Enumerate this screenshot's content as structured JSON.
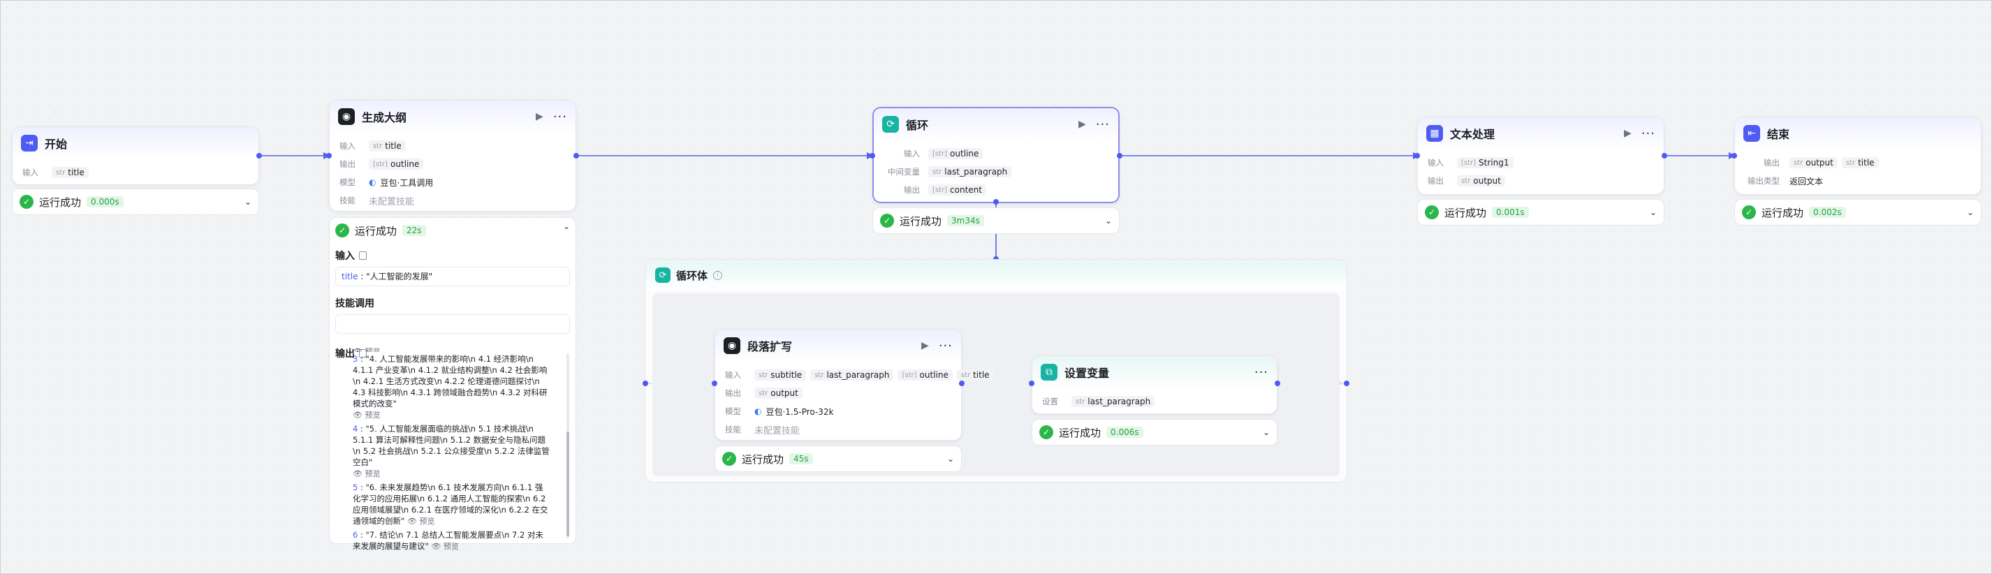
{
  "nodes": {
    "start": {
      "title": "开始",
      "input_label": "输入",
      "input_type": "str",
      "input_value": "title"
    },
    "outline": {
      "title": "生成大纲",
      "input_label": "输入",
      "input_type": "str",
      "input_value": "title",
      "output_label": "输出",
      "output_type": "[str]",
      "output_value": "outline",
      "model_label": "模型",
      "model_value": "豆包·工具调用",
      "skill_label": "技能",
      "skill_value": "未配置技能"
    },
    "loop": {
      "title": "循环",
      "input_label": "输入",
      "input_type": "[str]",
      "input_value": "outline",
      "mid_label": "中间变量",
      "mid_type": "str",
      "mid_value": "last_paragraph",
      "output_label": "输出",
      "output_type": "[str]",
      "output_value": "content"
    },
    "text": {
      "title": "文本处理",
      "input_label": "输入",
      "input_type": "[str]",
      "input_value": "String1",
      "output_label": "输出",
      "output_type": "str",
      "output_value": "output"
    },
    "end": {
      "title": "结束",
      "output_label": "输出",
      "output_type1": "str",
      "output_value1": "output",
      "output_type2": "str",
      "output_value2": "title",
      "otype_label": "输出类型",
      "otype_value": "返回文本"
    },
    "loopbody": {
      "title": "循环体"
    },
    "paragraph": {
      "title": "段落扩写",
      "input_label": "输入",
      "inputs": [
        {
          "type": "str",
          "value": "subtitle"
        },
        {
          "type": "str",
          "value": "last_paragraph"
        },
        {
          "type": "[str]",
          "value": "outline"
        },
        {
          "type": "str",
          "value": "title"
        }
      ],
      "output_label": "输出",
      "output_type": "str",
      "output_value": "output",
      "model_label": "模型",
      "model_value": "豆包·1.5-Pro-32k",
      "skill_label": "技能",
      "skill_value": "未配置技能"
    },
    "setvar": {
      "title": "设置变量",
      "set_label": "设置",
      "set_type": "str",
      "set_value": "last_paragraph"
    }
  },
  "status": {
    "text": "运行成功",
    "start_time": "0.000s",
    "outline_time": "22s",
    "loop_time": "3m34s",
    "text_time": "0.001s",
    "end_time": "0.002s",
    "paragraph_time": "45s",
    "setvar_time": "0.006s"
  },
  "panel": {
    "input_title": "输入",
    "input_key": "title",
    "input_value": "\"人工智能的发展\"",
    "skill_title": "技能调用",
    "output_title": "输出",
    "cut_preview": "预览",
    "preview_label": "预览",
    "items": [
      {
        "idx": "3",
        "text": "\"4. 人工智能发展带来的影响\\n 4.1 经济影响\\n 4.1.1 产业变革\\n 4.1.2 就业结构调整\\n 4.2 社会影响\\n 4.2.1 生活方式改变\\n 4.2.2 伦理道德问题探讨\\n 4.3 科技影响\\n 4.3.1 跨领域融合趋势\\n 4.3.2 对科研模式的改变\""
      },
      {
        "idx": "4",
        "text": "\"5. 人工智能发展面临的挑战\\n 5.1 技术挑战\\n 5.1.1 算法可解释性问题\\n 5.1.2 数据安全与隐私问题\\n 5.2 社会挑战\\n 5.2.1 公众接受度\\n 5.2.2 法律监管空白\""
      },
      {
        "idx": "5",
        "text": "\"6. 未来发展趋势\\n 6.1 技术发展方向\\n 6.1.1 强化学习的应用拓展\\n 6.1.2 通用人工智能的探索\\n 6.2 应用领域展望\\n 6.2.1 在医疗领域的深化\\n 6.2.2 在交通领域的创新\""
      },
      {
        "idx": "6",
        "text": "\"7. 结论\\n 7.1 总结人工智能发展要点\\n 7.2 对未来发展的展望与建议\""
      }
    ]
  },
  "colors": {
    "accent": "#4e5cf2",
    "success": "#2bb64a",
    "teal": "#17b3a3"
  },
  "icons": {
    "start": "login-icon",
    "llm": "ai-bot-icon",
    "loop": "loop-icon",
    "text": "text-process-icon",
    "end": "logout-icon",
    "setvar": "variable-icon"
  }
}
